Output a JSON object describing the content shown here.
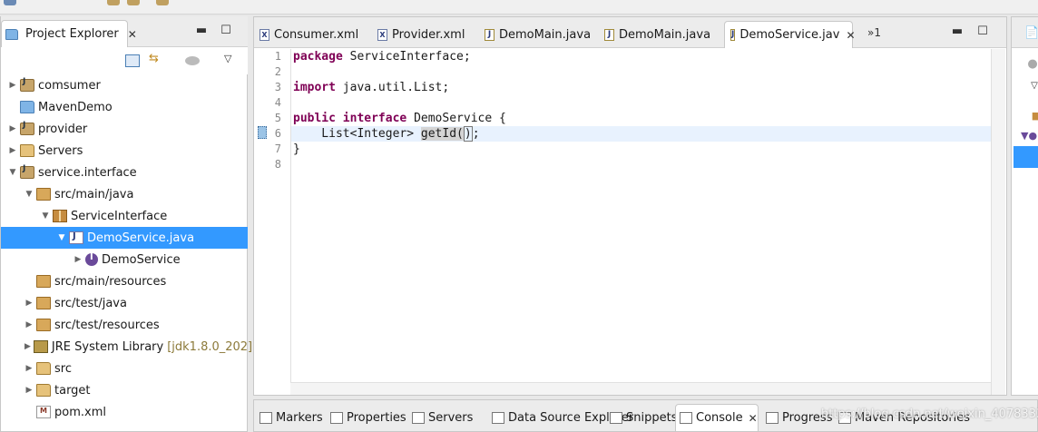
{
  "explorer": {
    "tab_label": "Project Explorer",
    "tree": [
      {
        "label": "comsumer",
        "icon": "maven-project-icon",
        "arrow": "collapsed",
        "indent": 0
      },
      {
        "label": "MavenDemo",
        "icon": "folder-project-icon",
        "arrow": "none",
        "indent": 0
      },
      {
        "label": "provider",
        "icon": "maven-project-icon",
        "arrow": "collapsed",
        "indent": 0
      },
      {
        "label": "Servers",
        "icon": "folder-icon",
        "arrow": "collapsed",
        "indent": 0
      },
      {
        "label": "service.interface",
        "icon": "maven-project-icon",
        "arrow": "expanded",
        "indent": 0
      },
      {
        "label": "src/main/java",
        "icon": "source-folder-icon",
        "arrow": "expanded",
        "indent": 1
      },
      {
        "label": "ServiceInterface",
        "icon": "package-icon",
        "arrow": "expanded",
        "indent": 2
      },
      {
        "label": "DemoService.java",
        "icon": "java-file-icon",
        "arrow": "expanded",
        "indent": 3,
        "selected": true
      },
      {
        "label": "DemoService",
        "icon": "interface-icon",
        "arrow": "collapsed",
        "indent": 4
      },
      {
        "label": "src/main/resources",
        "icon": "source-folder-icon",
        "arrow": "none",
        "indent": 1
      },
      {
        "label": "src/test/java",
        "icon": "source-folder-icon",
        "arrow": "collapsed",
        "indent": 1
      },
      {
        "label": "src/test/resources",
        "icon": "source-folder-icon",
        "arrow": "collapsed",
        "indent": 1
      },
      {
        "label": "JRE System Library",
        "decoration": "[jdk1.8.0_202]",
        "icon": "library-icon",
        "arrow": "collapsed",
        "indent": 1
      },
      {
        "label": "src",
        "icon": "folder-icon",
        "arrow": "collapsed",
        "indent": 1
      },
      {
        "label": "target",
        "icon": "folder-icon",
        "arrow": "collapsed",
        "indent": 1
      },
      {
        "label": "pom.xml",
        "icon": "xml-file-icon",
        "arrow": "none",
        "indent": 1
      }
    ]
  },
  "editor": {
    "tabs": [
      {
        "label": "Consumer.xml",
        "type": "xml"
      },
      {
        "label": "Provider.xml",
        "type": "xml"
      },
      {
        "label": "DemoMain.java",
        "type": "java"
      },
      {
        "label": "DemoMain.java",
        "type": "java"
      },
      {
        "label": "DemoService.jav",
        "type": "java",
        "active": true
      }
    ],
    "more_tabs": "»1",
    "line_numbers": [
      "1",
      "2",
      "3",
      "4",
      "5",
      "6",
      "7",
      "8"
    ],
    "code": {
      "l1_kw": "package",
      "l1_rest": " ServiceInterface;",
      "l3_kw": "import",
      "l3_rest": " java.util.List;",
      "l5_kw1": "public",
      "l5_kw2": "interface",
      "l5_rest": " DemoService {",
      "l6_pre": "    List<Integer> ",
      "l6_method": "getId",
      "l6_paren_open": "(",
      "l6_paren_close": ")",
      "l6_end": ";",
      "l7": "}"
    }
  },
  "bottom": {
    "tabs": [
      {
        "label": "Markers"
      },
      {
        "label": "Properties"
      },
      {
        "label": "Servers"
      },
      {
        "label": "Data Source Explorer"
      },
      {
        "label": "Snippets"
      },
      {
        "label": "Console",
        "active": true
      },
      {
        "label": "Progress"
      },
      {
        "label": "Maven Repositories"
      }
    ],
    "watermark": "https://blog.csdn.net/weixin_40783338"
  },
  "colors": {
    "selection": "#3399ff",
    "keyword": "#7f0055",
    "current_line": "#e8f2fe"
  }
}
